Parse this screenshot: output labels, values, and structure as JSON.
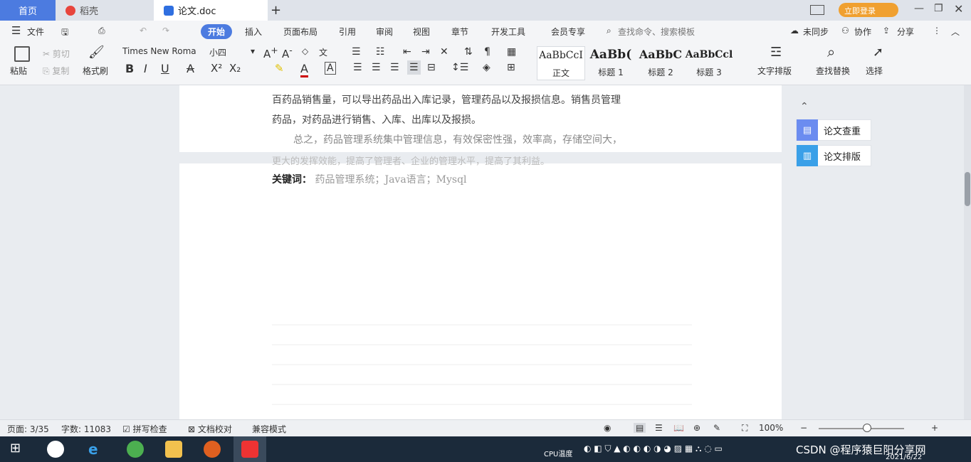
{
  "titlebar": {
    "tabs": [
      {
        "label": "首页"
      },
      {
        "label": "稻壳"
      },
      {
        "label": "论文.doc"
      }
    ],
    "login_label": "立即登录"
  },
  "menubar": {
    "file_label": "文件",
    "items": [
      "开始",
      "插入",
      "页面布局",
      "引用",
      "审阅",
      "视图",
      "章节",
      "开发工具",
      "会员专享"
    ],
    "search_placeholder": "查找命令、搜索模板",
    "sync_label": "未同步",
    "collab_label": "协作",
    "share_label": "分享"
  },
  "toolbar": {
    "paste_label": "粘贴",
    "cut_label": "剪切",
    "copy_label": "复制",
    "format_painter_label": "格式刷",
    "font_name": "Times New Roma",
    "font_size": "小四",
    "styles": [
      {
        "sample": "AaBbCcI",
        "label": "正文"
      },
      {
        "sample": "AaBb(",
        "label": "标题 1"
      },
      {
        "sample": "AaBbC",
        "label": "标题 2"
      },
      {
        "sample": "AaBbCcl",
        "label": "标题 3"
      }
    ],
    "text_layout_label": "文字排版",
    "find_replace_label": "查找替换",
    "select_label": "选择"
  },
  "document": {
    "lines": [
      "百药品销售量，可以导出药品出入库记录，管理药品以及报损信息。销售员管理",
      "药品，对药品进行销售、入库、出库以及报损。",
      "总之，药品管理系统集中管理信息，有效保密性强，效率高，存储空间大，",
      "更大的发挥效能，提高了管理者、企业的管理水平，提高了其利益。"
    ],
    "keywords_label": "关键词：",
    "keywords_value": "药品管理系统；Java语言；Mysql"
  },
  "sidepanel": {
    "check_label": "论文查重",
    "layout_label": "论文排版"
  },
  "statusbar": {
    "page": "页面: 3/35",
    "word_count": "字数: 11083",
    "spell_check": "拼写检查",
    "doc_proof": "文档校对",
    "compat_mode": "兼容模式",
    "zoom": "100%"
  },
  "taskbar": {
    "tray_text": "CSDN @程序猿巨阳分享网",
    "date": "2021/6/22",
    "cpu_label": "CPU温度"
  },
  "colors": {
    "accent": "#4c7be0",
    "login_badge": "#f0a030",
    "taskbar": "#1b2a3a"
  }
}
